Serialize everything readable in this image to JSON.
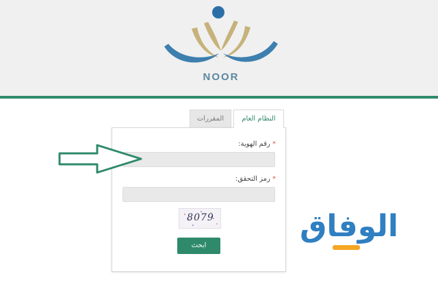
{
  "brand": {
    "name": "NOOR",
    "dot_color": "#2c6fa8",
    "gold_color": "#c6b27a",
    "blue_color": "#3d7fae"
  },
  "tabs": [
    {
      "label": "النظام العام",
      "active": true
    },
    {
      "label": "المقررات",
      "active": false
    }
  ],
  "form": {
    "id_label": "رقم الهوية:",
    "id_value": "",
    "captcha_label": "رمز التحقق:",
    "captcha_value": "",
    "required_mark": "*",
    "captcha_image_text": "8079",
    "search_label": "ابحث"
  },
  "watermark": {
    "text": "الوفاق",
    "color": "#2f7fc1",
    "accent": "#f5a623"
  },
  "arrow_icon": "arrow-right-icon",
  "accent_color": "#2f8a6b"
}
